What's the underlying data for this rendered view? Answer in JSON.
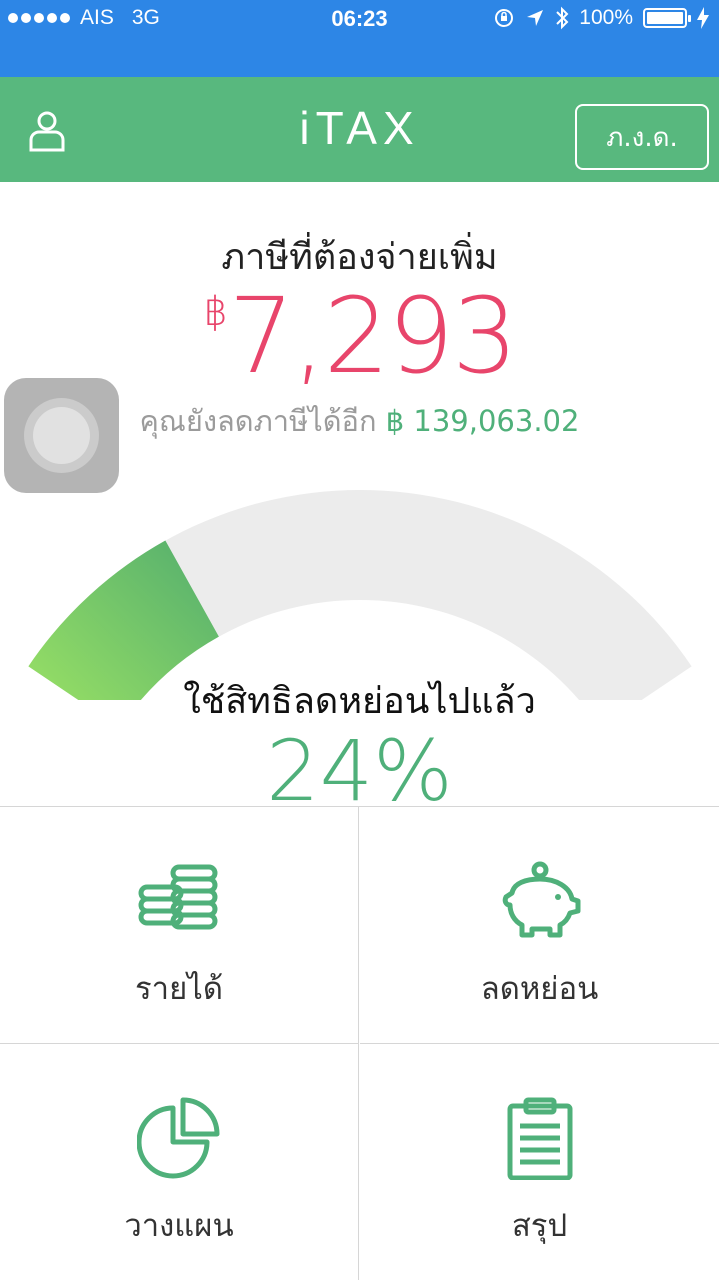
{
  "status_bar": {
    "carrier": "AIS",
    "network": "3G",
    "time": "06:23",
    "battery": "100%"
  },
  "nav": {
    "title": "iTAX",
    "pgd_button": "ภ.ง.ด."
  },
  "summary": {
    "tax_label": "ภาษีที่ต้องจ่ายเพิ่ม",
    "currency_symbol": "฿",
    "tax_amount": "7,293",
    "remaining_label": "คุณยังลดภาษีได้อีก",
    "remaining_amount": "฿ 139,063.02"
  },
  "gauge": {
    "label": "ใช้สิทธิลดหย่อนไปแล้ว",
    "percent_text": "24%",
    "fraction": 0.24
  },
  "menu": {
    "income": "รายได้",
    "deduction": "ลดหย่อน",
    "plan": "วางแผน",
    "summary": "สรุป"
  },
  "colors": {
    "status_bar": "#2d86e6",
    "nav_bar": "#58b87e",
    "tax_amount": "#e8456b",
    "accent_green": "#4fb07a",
    "gauge_track": "#ececec",
    "gauge_fill_start": "#9ee464",
    "gauge_fill_end": "#52ad6e"
  },
  "icons": [
    "user-icon",
    "coins-icon",
    "piggy-bank-icon",
    "pie-chart-icon",
    "clipboard-icon"
  ]
}
